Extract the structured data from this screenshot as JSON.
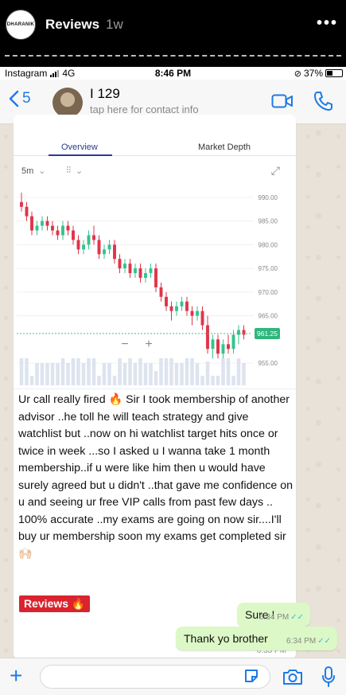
{
  "story": {
    "account": "Reviews",
    "time": "1w",
    "avatar_text": "DHARANIK",
    "more_icon": "more-dots-icon"
  },
  "status_bar": {
    "carrier": "Instagram",
    "network": "4G",
    "time": "8:46 PM",
    "battery": "37%"
  },
  "chat_header": {
    "back_count": "5",
    "contact_name": "I 129",
    "subtitle": "tap here for contact info"
  },
  "chart_card": {
    "tabs": [
      "Overview",
      "Market Depth"
    ],
    "interval": "5m",
    "zoom_minus": "−",
    "zoom_plus": "+"
  },
  "chart_data": {
    "type": "candlestick",
    "y_ticks": [
      "990.00",
      "985.00",
      "980.00",
      "975.00",
      "970.00",
      "965.00",
      "955.00"
    ],
    "ylim": [
      952,
      993
    ],
    "current_price": "961.25",
    "candles": [
      [
        989,
        991,
        987,
        988
      ],
      [
        988,
        989,
        985,
        986
      ],
      [
        986,
        987,
        982,
        983
      ],
      [
        983,
        985,
        982,
        984
      ],
      [
        984,
        986,
        983,
        985
      ],
      [
        985,
        986,
        983,
        984
      ],
      [
        984,
        985,
        982,
        983
      ],
      [
        983,
        984,
        981,
        982
      ],
      [
        982,
        985,
        981,
        984
      ],
      [
        984,
        985,
        982,
        983
      ],
      [
        983,
        984,
        980,
        981
      ],
      [
        981,
        982,
        978,
        979
      ],
      [
        979,
        981,
        978,
        980
      ],
      [
        980,
        983,
        979,
        982
      ],
      [
        982,
        984,
        980,
        981
      ],
      [
        981,
        982,
        977,
        978
      ],
      [
        978,
        980,
        977,
        979
      ],
      [
        979,
        981,
        978,
        980
      ],
      [
        980,
        981,
        976,
        977
      ],
      [
        977,
        978,
        974,
        975
      ],
      [
        975,
        977,
        974,
        976
      ],
      [
        976,
        977,
        973,
        974
      ],
      [
        974,
        976,
        973,
        975
      ],
      [
        975,
        976,
        972,
        973
      ],
      [
        973,
        975,
        972,
        974
      ],
      [
        974,
        976,
        973,
        975
      ],
      [
        975,
        976,
        970,
        971
      ],
      [
        971,
        972,
        968,
        969
      ],
      [
        969,
        970,
        966,
        967
      ],
      [
        967,
        968,
        964,
        966
      ],
      [
        966,
        968,
        965,
        967
      ],
      [
        967,
        969,
        966,
        968
      ],
      [
        968,
        969,
        965,
        966
      ],
      [
        966,
        967,
        963,
        965
      ],
      [
        965,
        967,
        964,
        966
      ],
      [
        966,
        967,
        962,
        963
      ],
      [
        963,
        965,
        957,
        958
      ],
      [
        958,
        961,
        956,
        960
      ],
      [
        960,
        961,
        956,
        957
      ],
      [
        957,
        960,
        956,
        959
      ],
      [
        959,
        961,
        957,
        958
      ],
      [
        958,
        962,
        957,
        961
      ],
      [
        961,
        963,
        959,
        962
      ],
      [
        962,
        963,
        960,
        961
      ]
    ]
  },
  "messages": {
    "incoming_text": "Ur call really fired 🔥 Sir I took  membership of another advisor ..he toll he will teach strategy and give watchlist but ..now on hi watchlist target hits once or twice in week ...so I asked u I wanna take 1 month membership..if u were like him then u would have surely agreed but u didn't ..that gave me confidence on u and seeing ur free VIP calls from past few days .. 100% accurate ..my exams are going on now sir....I'll buy ur membership soon my exams get completed sir 🙌🏻",
    "incoming_time": "6:33 PM",
    "outgoing": [
      {
        "text": "Sure !",
        "time": "6:34 PM"
      },
      {
        "text": "Thank yo brother",
        "time": "6:34 PM"
      }
    ]
  },
  "badge": {
    "label": "Reviews 🔥"
  },
  "colors": {
    "accent": "#1e7ae6",
    "outgoing_bubble": "#dcf8c6",
    "bull": "#34c38f",
    "bear": "#e0344a",
    "price_tag": "#2fb67c"
  }
}
